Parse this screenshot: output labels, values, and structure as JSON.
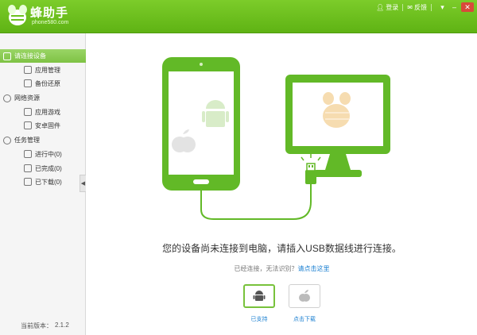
{
  "app": {
    "name": "蜂助手",
    "site": "phone580.com",
    "login_label": "登录",
    "feedback_label": "反馈"
  },
  "sidebar": {
    "sections": [
      {
        "label": "请连接设备",
        "icon": "phone-icon",
        "items": [
          {
            "label": "应用管理",
            "icon": "apps-grid-icon"
          },
          {
            "label": "备份还原",
            "icon": "backup-icon"
          }
        ]
      },
      {
        "label": "网络资源",
        "icon": "globe-icon",
        "items": [
          {
            "label": "应用游戏",
            "icon": "apps-grid-icon"
          },
          {
            "label": "安卓固件",
            "icon": "firmware-icon"
          }
        ]
      },
      {
        "label": "任务管理",
        "icon": "clock-icon",
        "items": [
          {
            "label": "进行中(0)",
            "icon": "progress-icon"
          },
          {
            "label": "已完成(0)",
            "icon": "check-icon"
          },
          {
            "label": "已下载(0)",
            "icon": "download-icon"
          }
        ]
      }
    ],
    "version_label": "当前版本：",
    "version": "2.1.2"
  },
  "main": {
    "message": "您的设备尚未连接到电脑，请插入USB数据线进行连接。",
    "sub_prefix": "已经连接，无法识别？",
    "sub_link": "请点击这里",
    "devices": [
      {
        "label": "已支持",
        "icon": "android-icon",
        "selected": true
      },
      {
        "label": "点击下载",
        "icon": "apple-icon",
        "selected": false
      }
    ]
  },
  "colors": {
    "brand_green": "#6cc21c",
    "illustration_green": "#62b927",
    "link_blue": "#1a7fd1"
  }
}
